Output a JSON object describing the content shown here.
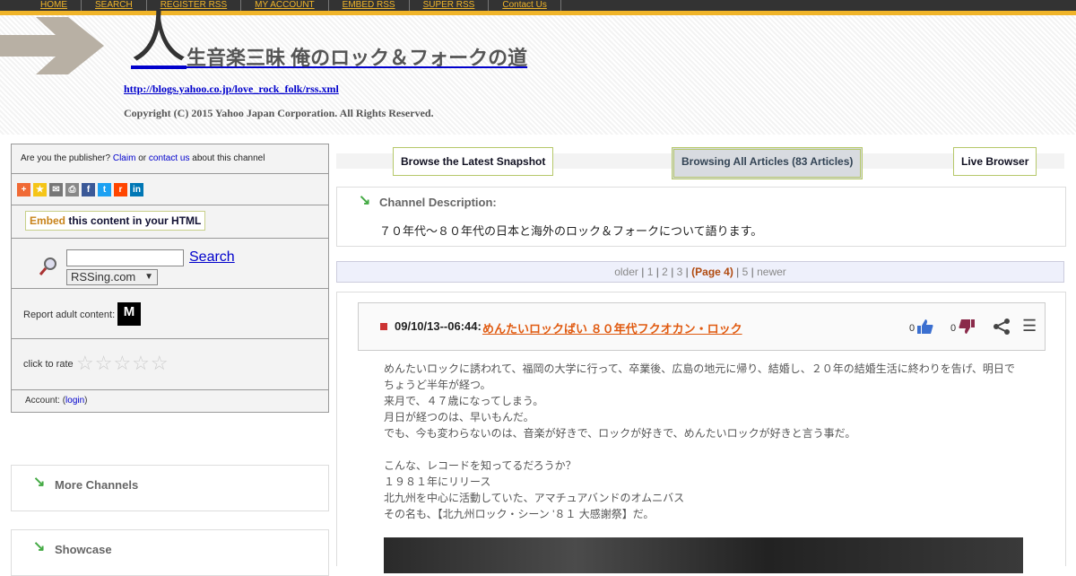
{
  "nav": [
    "HOME",
    "SEARCH",
    "REGISTER RSS",
    "MY ACCOUNT",
    "EMBED RSS",
    "SUPER RSS",
    "Contact Us"
  ],
  "header": {
    "kanji": "人",
    "title": "生音楽三昧 俺のロック＆フォークの道",
    "url": "http://blogs.yahoo.co.jp/love_rock_folk/rss.xml",
    "copyright": "Copyright (C) 2015 Yahoo Japan Corporation. All Rights Reserved."
  },
  "sidebar": {
    "publisher_prefix": "Are you the publisher?",
    "claim": "Claim",
    "or": "or",
    "contact": "contact us",
    "publisher_suffix": "about this channel",
    "embed_highlight": "Embed",
    "embed_text": "this content in your HTML",
    "search_button": "Search",
    "search_scope": "RSSing.com",
    "adult_label": "Report adult content:",
    "adult_badge": "M",
    "rate_label": "click to rate",
    "stars": "☆☆☆☆☆",
    "account_label": "Account: (",
    "login": "login",
    "account_close": ")",
    "more_channels": "More Channels",
    "showcase": "Showcase"
  },
  "tabs": {
    "latest": "Browse the Latest Snapshot",
    "all": "Browsing All Articles (83 Articles)",
    "live": "Live Browser"
  },
  "description": {
    "label": "Channel Description:",
    "text": "７０年代～８０年代の日本と海外のロック＆フォークについて語ります。"
  },
  "pager": {
    "older": "older",
    "p1": "1",
    "p2": "2",
    "p3": "3",
    "current": "(Page 4)",
    "p5": "5",
    "newer": "newer"
  },
  "article": {
    "date": "09/10/13--06:44:",
    "title": "めんたいロックばい ８０年代フクオカン・ロック",
    "likes": "0",
    "dislikes": "0",
    "lines": [
      "めんたいロックに誘われて、福岡の大学に行って、卒業後、広島の地元に帰り、結婚し、２０年の結婚生活に終わりを告げ、明日で",
      "ちょうど半年が経つ。",
      "来月で、４７歳になってしまう。",
      "月日が経つのは、早いもんだ。",
      "でも、今も変わらないのは、音楽が好きで、ロックが好きで、めんたいロックが好きと言う事だ。",
      " ",
      "こんな、レコードを知ってるだろうか？",
      "１９８１年にリリース",
      "北九州を中心に活動していた、アマチュアバンドのオムニバス",
      "その名も、【北九州ロック・シーン '８１ 大感謝祭】だ。"
    ]
  },
  "colors": {
    "nav_bg": "#333333",
    "nav_accent": "#f0b429",
    "link": "#0000cc",
    "article_title": "#e05a10"
  }
}
